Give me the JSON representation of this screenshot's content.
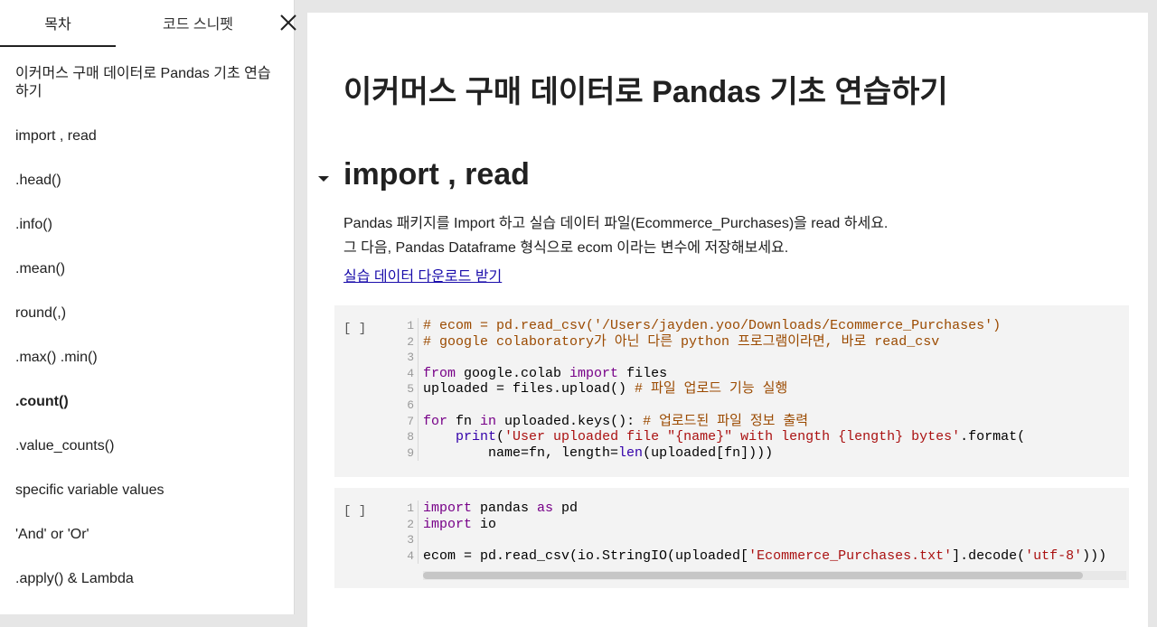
{
  "sidebar": {
    "tabs": [
      {
        "label": "목차"
      },
      {
        "label": "코드 스니펫"
      }
    ],
    "close_icon": "close-icon",
    "toc": [
      {
        "label": "이커머스 구매 데이터로 Pandas 기초 연습하기",
        "bold": false
      },
      {
        "label": "import , read",
        "bold": false
      },
      {
        "label": ".head()",
        "bold": false
      },
      {
        "label": ".info()",
        "bold": false
      },
      {
        "label": ".mean()",
        "bold": false
      },
      {
        "label": "round(,)",
        "bold": false
      },
      {
        "label": ".max() .min()",
        "bold": false
      },
      {
        "label": ".count()",
        "bold": true
      },
      {
        "label": ".value_counts()",
        "bold": false
      },
      {
        "label": "specific variable values",
        "bold": false
      },
      {
        "label": "'And' or 'Or'",
        "bold": false
      },
      {
        "label": ".apply() & Lambda",
        "bold": false
      }
    ]
  },
  "main": {
    "title": "이커머스 구매 데이터로 Pandas 기초 연습하기",
    "section": {
      "toggle_icon": "caret-down-icon",
      "heading": "import , read",
      "desc_line1": "Pandas 패키지를 Import 하고 실습 데이터 파일(Ecommerce_Purchases)을 read 하세요.",
      "desc_line2": "그 다음, Pandas Dataframe 형식으로 ecom 이라는 변수에 저장해보세요.",
      "link": "실습 데이터 다운로드 받기"
    },
    "cells": [
      {
        "run_label": "[ ]",
        "lines": [
          [
            [
              "comment",
              "# ecom = pd.read_csv('/Users/jayden.yoo/Downloads/Ecommerce_Purchases')"
            ]
          ],
          [
            [
              "comment",
              "# google colaboratory가 아닌 다른 python 프로그램이라면, 바로 read_csv"
            ]
          ],
          [],
          [
            [
              "kw",
              "from"
            ],
            [
              "plain",
              " google.colab "
            ],
            [
              "kw",
              "import"
            ],
            [
              "plain",
              " files"
            ]
          ],
          [
            [
              "plain",
              "uploaded = files.upload() "
            ],
            [
              "comment",
              "# 파일 업로드 기능 실행"
            ]
          ],
          [],
          [
            [
              "kw",
              "for"
            ],
            [
              "plain",
              " fn "
            ],
            [
              "kw",
              "in"
            ],
            [
              "plain",
              " uploaded.keys(): "
            ],
            [
              "comment",
              "# 업로드된 파일 정보 출력"
            ]
          ],
          [
            [
              "plain",
              "    "
            ],
            [
              "builtin",
              "print"
            ],
            [
              "plain",
              "("
            ],
            [
              "str",
              "'User uploaded file \"{name}\" with length {length} bytes'"
            ],
            [
              "plain",
              ".format("
            ]
          ],
          [
            [
              "plain",
              "        name=fn, length="
            ],
            [
              "builtin",
              "len"
            ],
            [
              "plain",
              "(uploaded[fn])))"
            ]
          ]
        ]
      },
      {
        "run_label": "[ ]",
        "lines": [
          [
            [
              "kw",
              "import"
            ],
            [
              "plain",
              " pandas "
            ],
            [
              "kw",
              "as"
            ],
            [
              "plain",
              " pd"
            ]
          ],
          [
            [
              "kw",
              "import"
            ],
            [
              "plain",
              " io"
            ]
          ],
          [],
          [
            [
              "plain",
              "ecom = pd.read_csv(io.StringIO(uploaded["
            ],
            [
              "str",
              "'Ecommerce_Purchases.txt'"
            ],
            [
              "plain",
              "].decode("
            ],
            [
              "str",
              "'utf-8'"
            ],
            [
              "plain",
              ")))"
            ]
          ]
        ]
      }
    ]
  }
}
